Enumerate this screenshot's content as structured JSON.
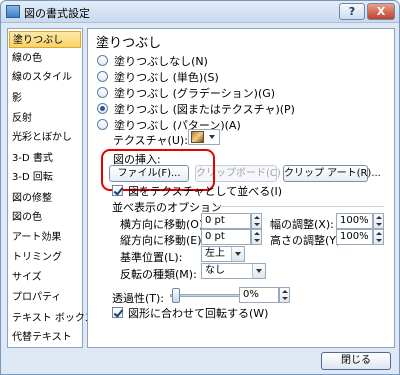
{
  "window": {
    "title": "図の書式設定",
    "help_label": "?",
    "close_label": "X"
  },
  "sidebar": {
    "items": [
      {
        "label": "塗りつぶし"
      },
      {
        "label": "線の色"
      },
      {
        "label": "線のスタイル"
      },
      {
        "label": "影"
      },
      {
        "label": "反射"
      },
      {
        "label": "光彩とぼかし"
      },
      {
        "label": "3-D 書式"
      },
      {
        "label": "3-D 回転"
      },
      {
        "label": "図の修整"
      },
      {
        "label": "図の色"
      },
      {
        "label": "アート効果"
      },
      {
        "label": "トリミング"
      },
      {
        "label": "サイズ"
      },
      {
        "label": "プロパティ"
      },
      {
        "label": "テキスト ボックス"
      },
      {
        "label": "代替テキスト"
      }
    ],
    "selected_index": 0
  },
  "panel": {
    "heading": "塗りつぶし",
    "fill_options": [
      {
        "label": "塗りつぶしなし(N)",
        "selected": false
      },
      {
        "label": "塗りつぶし (単色)(S)",
        "selected": false
      },
      {
        "label": "塗りつぶし (グラデーション)(G)",
        "selected": false
      },
      {
        "label": "塗りつぶし (図またはテクスチャ)(P)",
        "selected": true
      },
      {
        "label": "塗りつぶし (パターン)(A)",
        "selected": false
      }
    ],
    "texture_label": "テクスチャ(U):",
    "insert_label": "図の挿入:",
    "file_button": "ファイル(F)...",
    "clipboard_button": "クリップボード(C)",
    "clipart_button": "クリップ アート(R)...",
    "tile_checkbox": "図をテクスチャとして並べる(I)",
    "tile_options_label": "並べ表示のオプション",
    "offset_x_label": "横方向に移動(O):",
    "offset_x_value": "0 pt",
    "scale_x_label": "幅の調整(X):",
    "scale_x_value": "100%",
    "offset_y_label": "縦方向に移動(E):",
    "offset_y_value": "0 pt",
    "scale_y_label": "高さの調整(Y):",
    "scale_y_value": "100%",
    "alignment_label": "基準位置(L):",
    "alignment_value": "左上",
    "mirror_label": "反転の種類(M):",
    "mirror_value": "なし",
    "transparency_label": "透過性(T):",
    "transparency_value": "0%",
    "transparency_level": 0,
    "rotate_checkbox": "図形に合わせて回転する(W)"
  },
  "footer": {
    "close_button": "閉じる"
  }
}
